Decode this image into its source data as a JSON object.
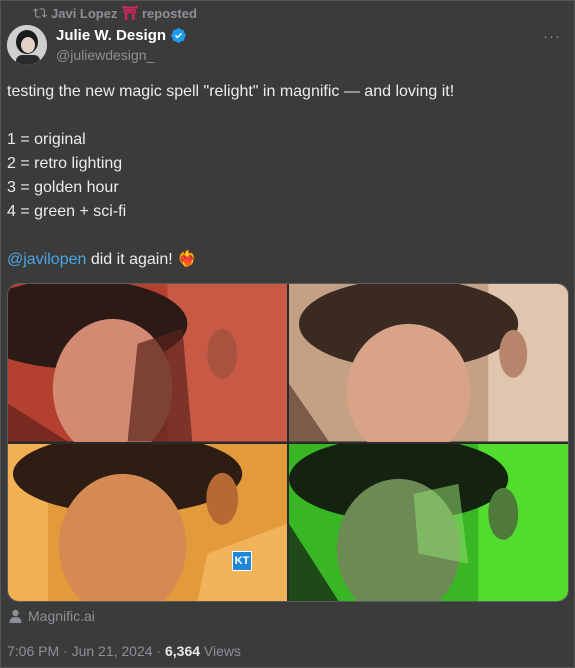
{
  "repost": {
    "icon": "repost-icon",
    "name": "Javi Lopez",
    "emoji": "⛩",
    "label": "reposted"
  },
  "author": {
    "display_name": "Julie W. Design",
    "handle": "@juliewdesign_",
    "verified_color": "#1d9bf0"
  },
  "more_label": "···",
  "tweet": {
    "line1": "testing the new magic spell \"relight\" in magnific — and loving it!",
    "list": [
      "1 = original",
      "2 = retro lighting",
      "3 = golden hour",
      "4 = green + sci-fi"
    ],
    "mention": "@javilopen",
    "tail": " did it again!",
    "emoji": "❤️‍🔥"
  },
  "images": [
    {
      "name": "original",
      "tint": "#c0473a"
    },
    {
      "name": "retro lighting",
      "tint": "#c9a98a"
    },
    {
      "name": "golden hour",
      "tint": "#e8a545"
    },
    {
      "name": "green + sci-fi",
      "tint": "#3fcf2a"
    }
  ],
  "watermark": "KT",
  "source": {
    "icon": "person-icon",
    "label": "Magnific.ai"
  },
  "meta": {
    "time": "7:06 PM · Jun 21, 2024 · ",
    "views_count": "6,364",
    "views_label": " Views"
  }
}
